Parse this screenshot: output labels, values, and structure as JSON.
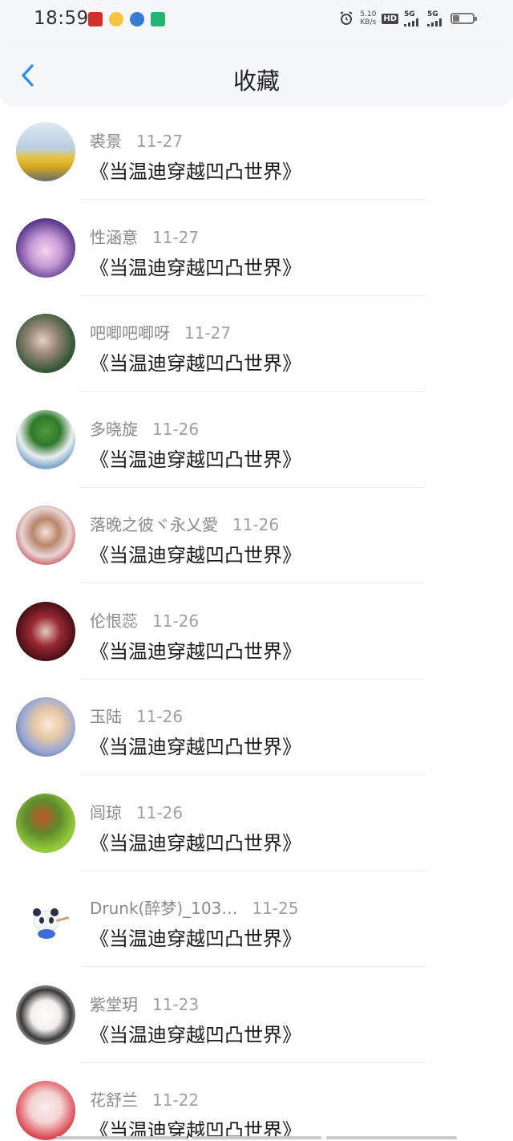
{
  "status_bar": {
    "time": "18:59",
    "net_speed_value": "5.10",
    "net_speed_unit": "KB/s",
    "hd_label": "HD",
    "sim1_label": "5G",
    "sim2_label": "5G",
    "icons": [
      "notification-app-icon",
      "notification-app-icon",
      "notification-app-icon",
      "notification-app-icon",
      "alarm-icon",
      "signal-icon",
      "battery-icon"
    ]
  },
  "nav": {
    "title": "收藏",
    "back_icon": "chevron-left-icon",
    "accent_color": "#2d8cf0"
  },
  "favorites": [
    {
      "author": "裘景",
      "date": "11-27",
      "title": "《当温迪穿越凹凸世界》"
    },
    {
      "author": "性涵意",
      "date": "11-27",
      "title": "《当温迪穿越凹凸世界》"
    },
    {
      "author": "吧唧吧唧呀",
      "date": "11-27",
      "title": "《当温迪穿越凹凸世界》"
    },
    {
      "author": "多晓旋",
      "date": "11-26",
      "title": "《当温迪穿越凹凸世界》"
    },
    {
      "author": "落晚之彼ヾ永乂愛",
      "date": "11-26",
      "title": "《当温迪穿越凹凸世界》"
    },
    {
      "author": "伦恨蕊",
      "date": "11-26",
      "title": "《当温迪穿越凹凸世界》"
    },
    {
      "author": "玉陆",
      "date": "11-26",
      "title": "《当温迪穿越凹凸世界》"
    },
    {
      "author": "闾琼",
      "date": "11-26",
      "title": "《当温迪穿越凹凸世界》"
    },
    {
      "author": "Drunk(醉梦)_103…",
      "date": "11-25",
      "title": "《当温迪穿越凹凸世界》"
    },
    {
      "author": "紫堂玥",
      "date": "11-23",
      "title": "《当温迪穿越凹凸世界》"
    },
    {
      "author": "花舒兰",
      "date": "11-22",
      "title": "《当温迪穿越凹凸世界》"
    }
  ]
}
